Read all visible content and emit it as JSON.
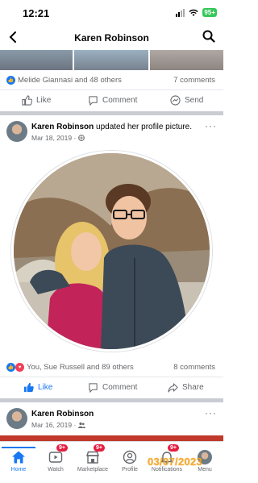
{
  "status_bar": {
    "time": "12:21",
    "battery": "95+"
  },
  "header": {
    "title": "Karen Robinson"
  },
  "post1": {
    "reactions_text": "Melide Giannasi and 48 others",
    "comments_text": "7 comments",
    "actions": {
      "like": "Like",
      "comment": "Comment",
      "send": "Send"
    }
  },
  "post2": {
    "author": "Karen Robinson",
    "action_text": " updated her profile picture.",
    "date": "Mar 18, 2019 ·",
    "more": "···",
    "reactions_text": "You, Sue Russell and 89 others",
    "comments_text": "8 comments",
    "actions": {
      "like": "Like",
      "comment": "Comment",
      "share": "Share"
    }
  },
  "post3": {
    "author": "Karen Robinson",
    "date": "Mar 16, 2019 ·",
    "more": "···"
  },
  "bottom_nav": {
    "items": [
      {
        "label": "Home",
        "icon": "home-icon",
        "active": true
      },
      {
        "label": "Watch",
        "icon": "watch-icon",
        "badge": "9+"
      },
      {
        "label": "Marketplace",
        "icon": "marketplace-icon",
        "badge": "9+"
      },
      {
        "label": "Profile",
        "icon": "profile-icon"
      },
      {
        "label": "Notifications",
        "icon": "bell-icon",
        "badge": "9+"
      },
      {
        "label": "Menu",
        "icon": "menu-avatar-icon"
      }
    ]
  },
  "watermark": "03/07/2023",
  "colors": {
    "accent": "#1877f2",
    "badge": "#e41e3f",
    "watermark": "#f5a623"
  }
}
